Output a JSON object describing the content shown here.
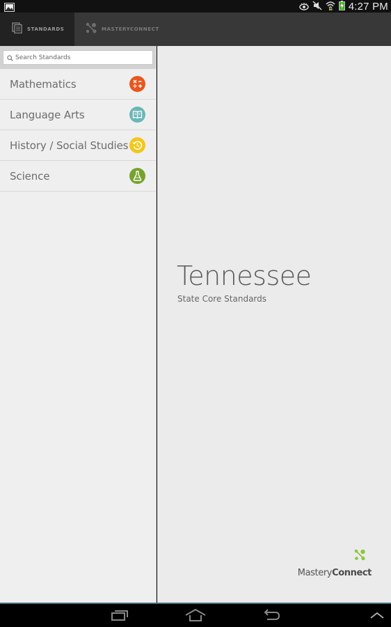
{
  "status_bar": {
    "time": "4:27 PM",
    "icons": [
      "gallery-notification-icon",
      "eye-icon",
      "mute-icon",
      "wifi-icon",
      "battery-charging-icon"
    ]
  },
  "topnav": {
    "tabs": [
      {
        "label": "STANDARDS",
        "icon": "documents-icon",
        "active": true
      },
      {
        "label": "MASTERYCONNECT",
        "icon": "masteryconnect-logo-icon",
        "active": false
      }
    ]
  },
  "sidebar": {
    "search": {
      "placeholder": "Search Standards",
      "value": ""
    },
    "items": [
      {
        "label": "Mathematics",
        "icon": "math-operators-icon",
        "color": "#e8561e"
      },
      {
        "label": "Language Arts",
        "icon": "open-book-icon",
        "color": "#6bb6b8"
      },
      {
        "label": "History / Social Studies",
        "icon": "history-clock-icon",
        "color": "#f2c71b"
      },
      {
        "label": "Science",
        "icon": "flask-icon",
        "color": "#77a22e"
      }
    ]
  },
  "main": {
    "title": "Tennessee",
    "subtitle": "State Core Standards",
    "brand": {
      "part1": "Mastery",
      "part2": "Connect",
      "accent": "#8cc63f"
    }
  },
  "navbar": {
    "buttons": [
      "recent-apps",
      "home",
      "back",
      "menu-up"
    ]
  }
}
